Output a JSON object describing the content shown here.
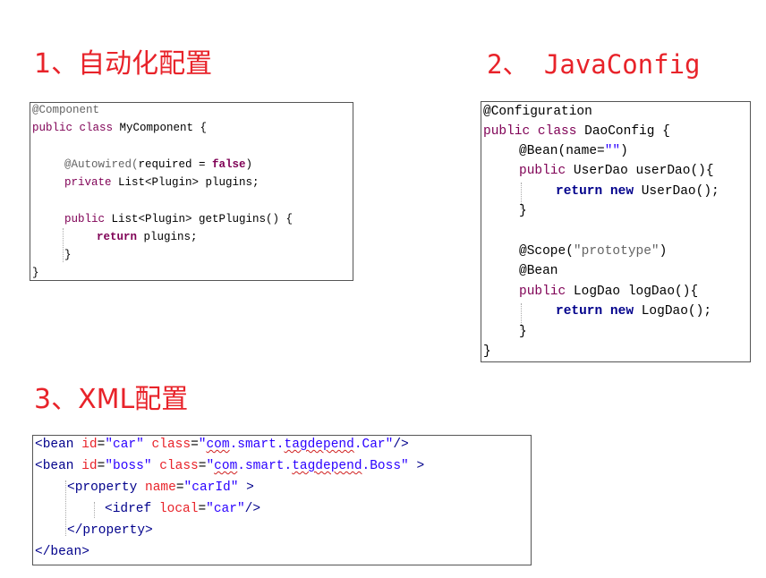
{
  "headings": {
    "h1": "1、自动化配置",
    "h2": "2、 JavaConfig",
    "h3": "3、XML配置"
  },
  "autowire_code": [
    "@Component",
    "public class MyComponent {",
    "@Autowired(required = false)",
    "private List<Plugin> plugins;",
    "public List<Plugin> getPlugins() {",
    "return plugins;",
    "}",
    "}"
  ],
  "javaconfig_code": [
    "@Configuration",
    "public class DaoConfig {",
    "@Bean(name=\"\")",
    "public UserDao userDao(){",
    "return new UserDao();",
    "}",
    "@Scope(\"prototype\")",
    "@Bean",
    "public LogDao logDao(){",
    "return new LogDao();",
    "}",
    "}"
  ],
  "xml_code": {
    "bean": "bean",
    "id_attr": "id",
    "class_attr": "class",
    "car_id": "\"car\"",
    "car_class_pre": "\"",
    "car_class_com": "com",
    "car_class_mid": ".smart.",
    "car_class_tag": "tagdepend",
    "car_class_end": ".Car\"",
    "boss_id": "\"boss\"",
    "boss_class_end": ".Boss\"",
    "property": "property",
    "name_attr": "name",
    "carId": "\"carId\"",
    "idref": "idref",
    "local_attr": "local",
    "local_val": "\"car\""
  }
}
